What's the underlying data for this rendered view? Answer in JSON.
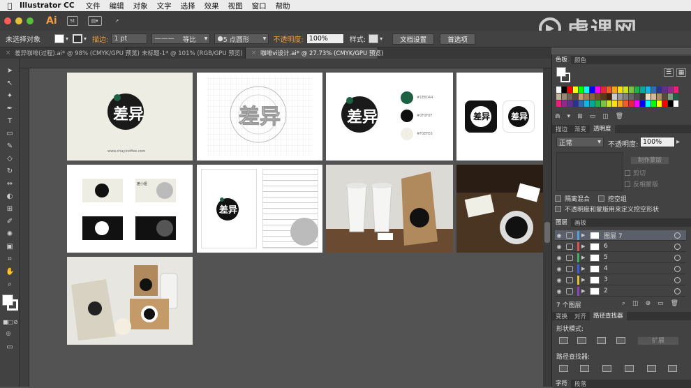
{
  "menubar": {
    "app_name": "Illustrator CC",
    "items": [
      "文件",
      "编辑",
      "对象",
      "文字",
      "选择",
      "效果",
      "视图",
      "窗口",
      "帮助"
    ]
  },
  "appbar": {
    "logo": "Ai"
  },
  "control_bar": {
    "selection_label": "未选择对象",
    "stroke_label": "描边:",
    "stroke_value": "1 pt",
    "stroke_profile": "等比",
    "brush_value": "5 点圆形",
    "opacity_label": "不透明度:",
    "opacity_value": "100%",
    "style_label": "样式:",
    "doc_setup_label": "文档设置",
    "prefs_label": "首选项"
  },
  "tabs": [
    {
      "label": "差异咖啡(过程).ai* @ 98% (CMYK/GPU 预览)",
      "active": false
    },
    {
      "label": "未标题-1* @ 101% (RGB/GPU 预览)",
      "active": false
    },
    {
      "label": "咖啡vi设计.ai* @ 27.73% (CMYK/GPU 预览)",
      "active": true
    }
  ],
  "watermark": "虎课网",
  "artboards": {
    "logo_text": "差异",
    "website": "www.chayicoffee.com",
    "color_codes": [
      "#1E6044",
      "#0F0F0F",
      "#F0EFE6"
    ],
    "card_name": "差小姐"
  },
  "color_panel": {
    "tabs": [
      "色板",
      "颜色"
    ]
  },
  "transparency_panel": {
    "tabs": [
      "描边",
      "渐变",
      "透明度"
    ],
    "blend_mode": "正常",
    "opacity_label": "不透明度:",
    "opacity_value": "100%",
    "make_mask_label": "制作蒙版",
    "clip_label": "剪切",
    "invert_label": "反相蒙版",
    "isolate_label": "隔离混合",
    "knockout_label": "挖空组",
    "opacity_mask_label": "不透明度和蒙版用来定义挖空形状"
  },
  "layers_panel": {
    "tabs": [
      "图层",
      "画板"
    ],
    "layers": [
      {
        "name": "图层 7",
        "color": "#4fa0e0",
        "selected": true
      },
      {
        "name": "6",
        "color": "#e05050",
        "selected": false
      },
      {
        "name": "5",
        "color": "#40b060",
        "selected": false
      },
      {
        "name": "4",
        "color": "#3a5ee0",
        "selected": false
      },
      {
        "name": "3",
        "color": "#e0c030",
        "selected": false
      },
      {
        "name": "2",
        "color": "#9040c0",
        "selected": false
      }
    ],
    "count_label": "7 个图层"
  },
  "pathfinder_panel": {
    "tabs": [
      "变换",
      "对齐",
      "路径查找器"
    ],
    "shape_modes_label": "形状模式:",
    "expand_label": "扩展",
    "pathfinders_label": "路径查找器:"
  },
  "bottom_panel": {
    "tabs": [
      "字符",
      "段落"
    ]
  }
}
